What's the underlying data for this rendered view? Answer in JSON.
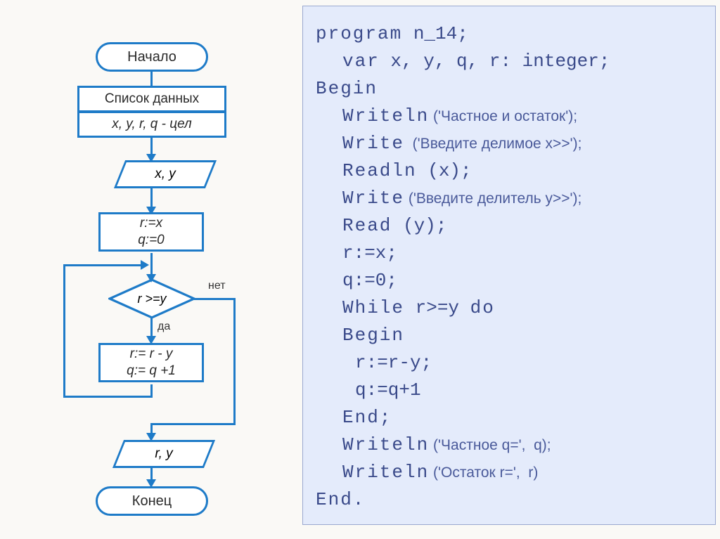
{
  "flowchart": {
    "start": "Начало",
    "datalist": "Список данных",
    "vars": "x, y, r, q - цел",
    "io_in": "x, y",
    "init": "r:=x\nq:=0",
    "cond": "r >=y",
    "no": "нет",
    "yes": "да",
    "loop_body": "r:= r - y\nq:= q +1",
    "io_out": "r, y",
    "end": "Конец"
  },
  "code": {
    "l1_kw": "program",
    "l1_rest": " n_14;",
    "l2_kw": "var",
    "l2_rest": " x, y, q, r: integer;",
    "l3": "Begin",
    "l4_kw": "Writeln",
    "l4_arg": " ('Частное и остаток');",
    "l5_kw": "Write",
    "l5_arg": "  ('Введите делимое x>>');",
    "l6_kw": "Readln",
    "l6_rest": " (x);",
    "l7_kw": "Write",
    "l7_arg": " ('Введите делитель y>>');",
    "l8_kw": "Read",
    "l8_rest": " (y);",
    "l9": "r:=x;",
    "l10": "q:=0;",
    "l11_kw1": "While",
    "l11_mid": " r>=y ",
    "l11_kw2": "do",
    "l12": "Begin",
    "l13": "r:=r-y;",
    "l14": "q:=q+1",
    "l15": "End;",
    "l16_kw": "Writeln",
    "l16_arg": " ('Частное q=',  q);",
    "l17_kw": "Writeln",
    "l17_arg": " ('Остаток r=',  r)",
    "l18": "End."
  }
}
